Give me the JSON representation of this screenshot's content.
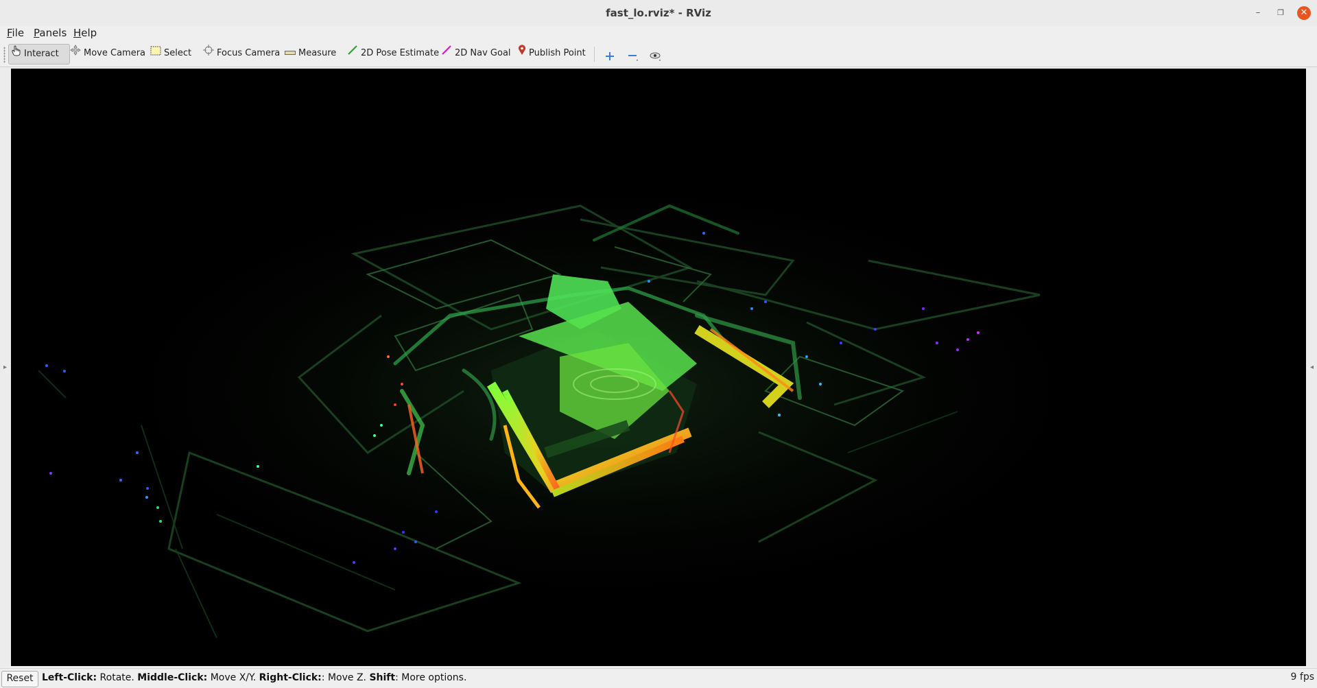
{
  "window": {
    "title": "fast_lo.rviz* - RViz"
  },
  "menu": [
    {
      "mnemonic": "F",
      "rest": "ile"
    },
    {
      "mnemonic": "P",
      "rest": "anels"
    },
    {
      "mnemonic": "H",
      "rest": "elp"
    }
  ],
  "toolbar": {
    "interact": "Interact",
    "move_camera": "Move Camera",
    "select": "Select",
    "focus_camera": "Focus Camera",
    "measure": "Measure",
    "pose_estimate": "2D Pose Estimate",
    "nav_goal": "2D Nav Goal",
    "publish_point": "Publish Point",
    "active_tool": "Interact"
  },
  "icons": {
    "interact": "hand-pointer-icon",
    "move_camera": "move-arrows-icon",
    "select": "selection-box-icon",
    "focus_camera": "focus-target-icon",
    "measure": "ruler-icon",
    "pose_estimate": "green-arrow-icon",
    "nav_goal": "magenta-arrow-icon",
    "publish_point": "map-pin-icon",
    "add_tool": "plus-icon",
    "remove_tool": "minus-icon",
    "view_options": "eye-icon"
  },
  "colors": {
    "pose_estimate": "#22aa22",
    "nav_goal": "#d020c0",
    "publish_point": "#c0392b",
    "close_button": "#e95420",
    "toolbar_plus": "#3a7bd5"
  },
  "statusbar": {
    "reset_label": "Reset",
    "help": [
      {
        "key": "Left-Click:",
        "action": " Rotate. "
      },
      {
        "key": "Middle-Click:",
        "action": " Move X/Y. "
      },
      {
        "key": "Right-Click:",
        "action": ": Move Z. "
      },
      {
        "key": "Shift",
        "action": ": More options."
      }
    ],
    "fps": "9 fps"
  }
}
